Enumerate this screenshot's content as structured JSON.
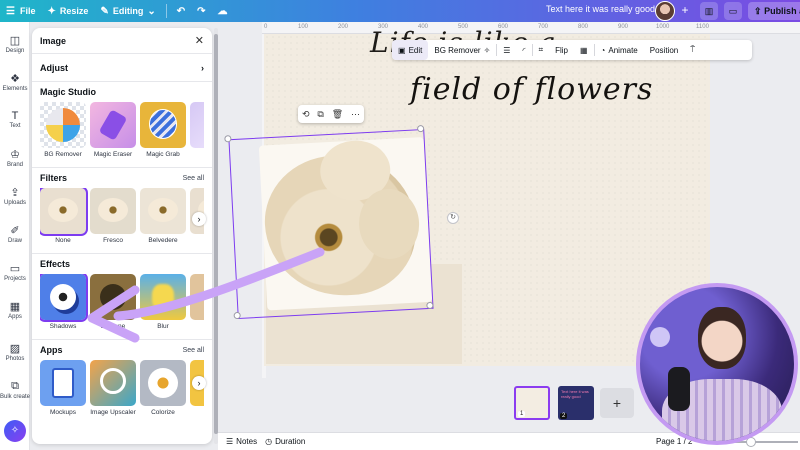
{
  "topbar": {
    "file": "File",
    "resize": "Resize",
    "editing": "Editing",
    "doc_title": "Text here it was really good",
    "publish": "Publish a"
  },
  "rail": {
    "items": [
      "Design",
      "Elements",
      "Text",
      "Brand",
      "Uploads",
      "Draw",
      "Projects",
      "Apps",
      "Photos",
      "Bulk create"
    ]
  },
  "panel": {
    "title": "Image",
    "adjust": "Adjust",
    "magic_studio": {
      "title": "Magic Studio",
      "tiles": [
        "BG Remover",
        "Magic Eraser",
        "Magic Grab",
        "G"
      ]
    },
    "filters": {
      "title": "Filters",
      "see_all": "See all",
      "tiles": [
        "None",
        "Fresco",
        "Belvedere"
      ]
    },
    "effects": {
      "title": "Effects",
      "tiles": [
        "Shadows",
        "Duotone",
        "Blur",
        "A"
      ]
    },
    "apps": {
      "title": "Apps",
      "see_all": "See all",
      "tiles": [
        "Mockups",
        "Image Upscaler",
        "Colorize"
      ]
    }
  },
  "ruler": [
    "0",
    "100",
    "200",
    "300",
    "400",
    "500",
    "600",
    "700",
    "800",
    "900",
    "1000",
    "1100"
  ],
  "canvas": {
    "script_top": "Life is like a",
    "script_main": "field of flowers"
  },
  "context_toolbar": {
    "edit": "Edit",
    "bg_remover": "BG Remover",
    "flip": "Flip",
    "animate": "Animate",
    "position": "Position"
  },
  "pages": {
    "p1": "1",
    "p2": "2",
    "p2_text": "Text here it was really good"
  },
  "bottom": {
    "notes": "Notes",
    "duration": "Duration",
    "page_indicator": "Page 1 / 2"
  },
  "colors": {
    "accent": "#7d3cf0",
    "arrow": "#c9a3f7"
  }
}
